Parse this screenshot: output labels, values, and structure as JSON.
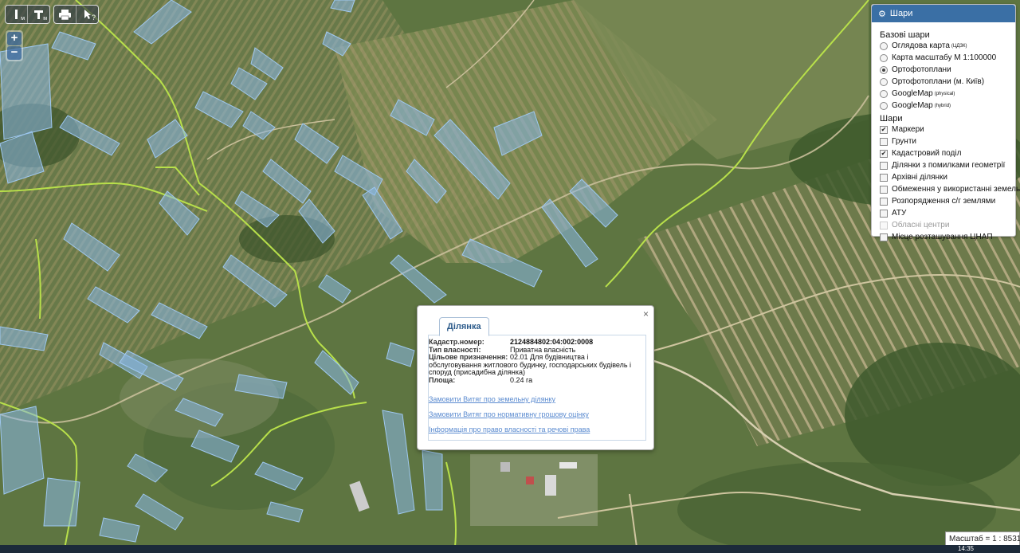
{
  "toolbar": {
    "measure_line": {
      "icon": "ruler-line-icon",
      "sub": "м"
    },
    "measure_area": {
      "icon": "ruler-area-icon",
      "sub": "м"
    },
    "print": {
      "icon": "printer-icon"
    },
    "identify": {
      "icon": "pointer-help-icon",
      "sub": "?"
    }
  },
  "zoom": {
    "in": "+",
    "out": "−"
  },
  "layers_panel": {
    "title": "Шари",
    "base_title": "Базові шари",
    "base_layers": [
      {
        "label": "Оглядова карта",
        "sup": "(ЦДЗК)",
        "selected": false
      },
      {
        "label": "Карта масштабу М 1:100000",
        "sup": "",
        "selected": false
      },
      {
        "label": "Ортофотоплани",
        "sup": "",
        "selected": true
      },
      {
        "label": "Ортофотоплани (м. Київ)",
        "sup": "",
        "selected": false
      },
      {
        "label": "GoogleMap",
        "sup": "(physical)",
        "selected": false
      },
      {
        "label": "GoogleMap",
        "sup": "(hybrid)",
        "selected": false
      }
    ],
    "overlay_title": "Шари",
    "overlays": [
      {
        "label": "Маркери",
        "checked": true,
        "disabled": false
      },
      {
        "label": "Грунти",
        "checked": false,
        "disabled": false
      },
      {
        "label": "Кадастровий поділ",
        "checked": true,
        "disabled": false
      },
      {
        "label": "Ділянки з помилками геометрії",
        "checked": false,
        "disabled": false
      },
      {
        "label": "Архівні ділянки",
        "checked": false,
        "disabled": false
      },
      {
        "label": "Обмеження у використанні земель",
        "checked": false,
        "disabled": false
      },
      {
        "label": "Розпорядження с/г землями",
        "checked": false,
        "disabled": false
      },
      {
        "label": "АТУ",
        "checked": false,
        "disabled": false
      },
      {
        "label": "Обласні центри",
        "checked": false,
        "disabled": true
      },
      {
        "label": "Місце розташування ЦНАП",
        "checked": false,
        "disabled": false
      }
    ]
  },
  "popup": {
    "close": "×",
    "tab": "Ділянка",
    "cadastral_label": "Кадастр.номер:",
    "cadastral_value": "2124884802:04:002:0008",
    "ownership_label": "Тип власності:",
    "ownership_value": "Приватна власність",
    "purpose_label": "Цільове призначення:",
    "purpose_value": "02.01 Для будівництва і",
    "purpose_cont": "обслуговування житлового будинку, господарських будівель і споруд (присадибна ділянка)",
    "area_label": "Площа:",
    "area_value": "0.24 га",
    "links": [
      "Замовити Витяг про земельну ділянку",
      "Замовити Витяг про нормативну грошову оцінку",
      "Інформація про право власності та речові права"
    ]
  },
  "scale": {
    "label": "Масштаб = 1 : 8531"
  },
  "taskbar": {
    "time": "14:35"
  },
  "colors": {
    "parcel_fill": "#8ab8e8",
    "boundary": "#b8e04a",
    "header": "#3a6fa5",
    "link": "#5b8bd0"
  }
}
